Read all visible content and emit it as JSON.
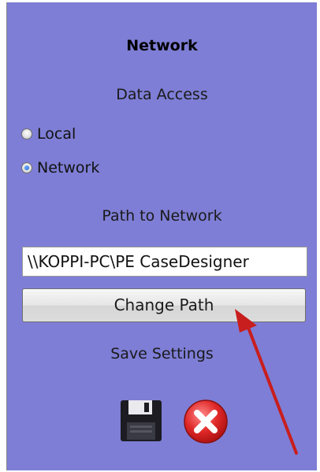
{
  "panel": {
    "title": "Network",
    "data_access_label": "Data Access",
    "options": [
      {
        "label": "Local",
        "selected": false
      },
      {
        "label": "Network",
        "selected": true
      }
    ],
    "path_label": "Path to Network",
    "path_value": "\\\\KOPPI-PC\\PE CaseDesigner",
    "change_path_label": "Change Path",
    "save_settings_label": "Save Settings",
    "icons": {
      "save": "floppy-disk-icon",
      "cancel": "red-x-icon"
    }
  },
  "colors": {
    "panel_background": "#7e7ed6",
    "annotation_arrow": "#c81e1e",
    "cancel_icon": "#e03030"
  }
}
